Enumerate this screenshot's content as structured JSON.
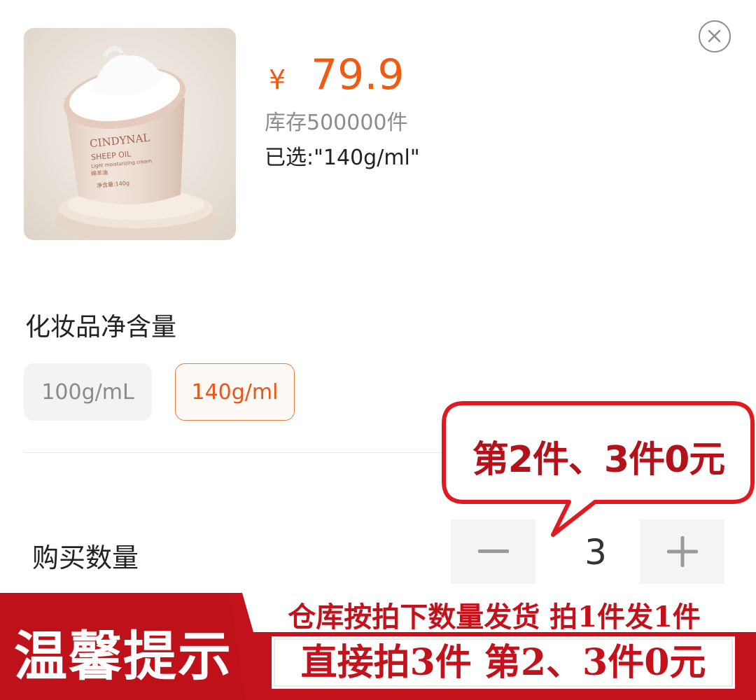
{
  "product": {
    "image_label": "CINDYNAL sheep oil cream jar",
    "brand": "CINDYNAL",
    "line": "SHEEP OIL",
    "sub_line": "Light moisturizing cream",
    "cn_name": "绵羊油",
    "net_weight": "净含量:140g"
  },
  "price": {
    "symbol": "¥",
    "value": "79.9"
  },
  "stock_text": "库存500000件",
  "selected_text": "已选:\"140g/ml\"",
  "spec": {
    "title": "化妆品净含量",
    "options": [
      {
        "label": "100g/mL",
        "selected": false
      },
      {
        "label": "140g/ml",
        "selected": true
      }
    ]
  },
  "quantity": {
    "label": "购买数量",
    "value": "3",
    "minus_icon": "minus-icon",
    "plus_icon": "plus-icon"
  },
  "promo_bubble": {
    "text": "第2件、3件0元",
    "border_color": "#e01a22",
    "text_color": "#b3121a"
  },
  "banner": {
    "title": "温馨提示",
    "line1": "仓库按拍下数量发货 拍1件发1件",
    "line2": "直接拍3件  第2、3件0元",
    "color": "#c4121c"
  },
  "colors": {
    "accent": "#f25a12"
  },
  "icons": {
    "close": "close-icon"
  }
}
